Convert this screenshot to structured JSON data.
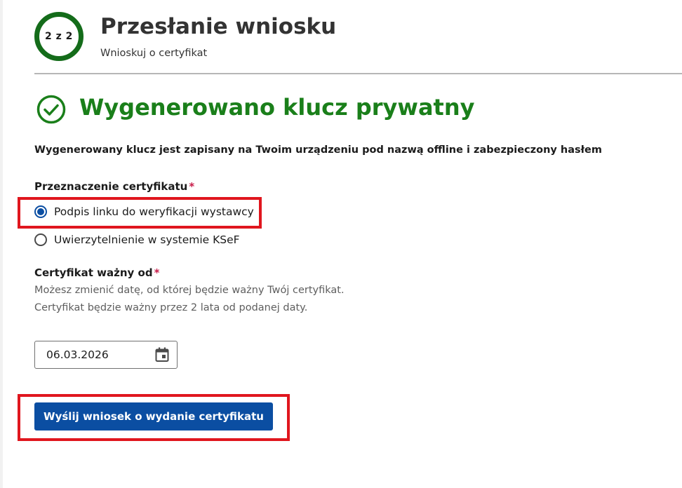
{
  "header": {
    "step_indicator": "2 z 2",
    "title": "Przesłanie wniosku",
    "subtitle": "Wnioskuj o certyfikat"
  },
  "success": {
    "icon": "check-circle-icon",
    "title": "Wygenerowano klucz prywatny",
    "info": "Wygenerowany klucz jest zapisany na Twoim urządzeniu pod nazwą offline i zabezpieczony hasłem"
  },
  "purpose": {
    "label": "Przeznaczenie certyfikatu",
    "required_mark": "*",
    "options": [
      {
        "label": "Podpis linku do weryfikacji wystawcy",
        "checked": true
      },
      {
        "label": "Uwierzytelnienie w systemie KSeF",
        "checked": false
      }
    ]
  },
  "valid_from": {
    "label": "Certyfikat ważny od",
    "required_mark": "*",
    "hint": "Możesz zmienić datę, od której będzie ważny Twój certyfikat. Certyfikat będzie ważny przez 2 lata od podanej daty.",
    "value": "06.03.2026",
    "icon": "calendar-icon"
  },
  "submit": {
    "label": "Wyślij wniosek o wydanie certyfikatu"
  },
  "colors": {
    "success_green": "#1a7f1a",
    "ring_green": "#146c1a",
    "primary_blue": "#0b4ea2",
    "required_red": "#c81e4b",
    "highlight_red": "#e0161e"
  }
}
